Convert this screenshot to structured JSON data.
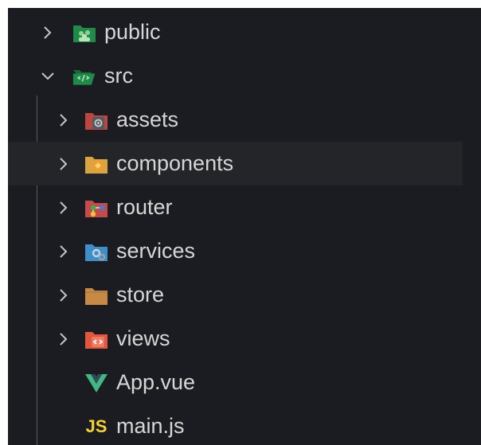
{
  "explorer": {
    "items": [
      {
        "label": "public",
        "icon": "folder-public-icon",
        "expandable": true,
        "expanded": false,
        "depth": 0
      },
      {
        "label": "src",
        "icon": "folder-src-open-icon",
        "expandable": true,
        "expanded": true,
        "depth": 0
      },
      {
        "label": "assets",
        "icon": "folder-assets-icon",
        "expandable": true,
        "expanded": false,
        "depth": 1
      },
      {
        "label": "components",
        "icon": "folder-components-icon",
        "expandable": true,
        "expanded": false,
        "depth": 1,
        "hovered": true
      },
      {
        "label": "router",
        "icon": "folder-router-icon",
        "expandable": true,
        "expanded": false,
        "depth": 1
      },
      {
        "label": "services",
        "icon": "folder-services-icon",
        "expandable": true,
        "expanded": false,
        "depth": 1
      },
      {
        "label": "store",
        "icon": "folder-store-icon",
        "expandable": true,
        "expanded": false,
        "depth": 1
      },
      {
        "label": "views",
        "icon": "folder-views-icon",
        "expandable": true,
        "expanded": false,
        "depth": 1
      },
      {
        "label": "App.vue",
        "icon": "vue-file-icon",
        "expandable": false,
        "depth": 1
      },
      {
        "label": "main.js",
        "icon": "javascript-file-icon",
        "expandable": false,
        "depth": 1,
        "icon_text": "JS"
      }
    ]
  },
  "colors": {
    "background": "#1b1c21",
    "hover_row": "#242529",
    "text": "#d6d6d6",
    "chevron": "#c5c5c5",
    "indent_guide": "#585858",
    "vue_green": "#41b883",
    "js_yellow": "#f3d22f"
  }
}
